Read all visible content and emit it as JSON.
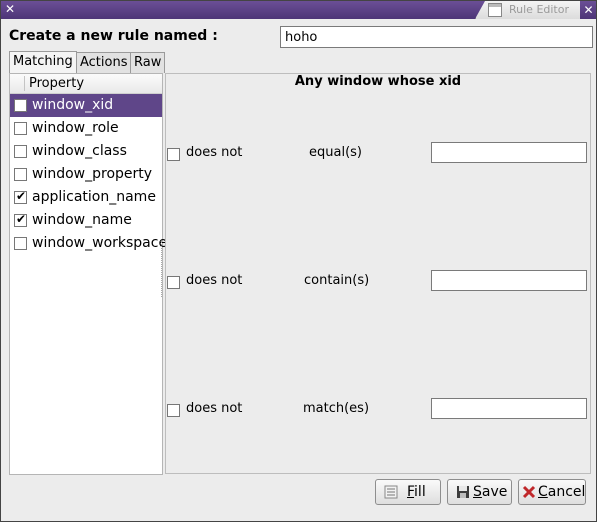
{
  "window": {
    "title": "Rule Editor",
    "menu_glyph": "✕",
    "close_glyph": "✕",
    "icon": "window-icon"
  },
  "form": {
    "name_label": "Create a new rule named :",
    "name_value": "hoho"
  },
  "tabs": [
    {
      "label": "Matching",
      "active": true
    },
    {
      "label": "Actions",
      "active": false
    },
    {
      "label": "Raw",
      "active": false
    }
  ],
  "property_list": {
    "header": "Property",
    "items": [
      {
        "label": "window_xid",
        "checked": false,
        "selected": true
      },
      {
        "label": "window_role",
        "checked": false,
        "selected": false
      },
      {
        "label": "window_class",
        "checked": false,
        "selected": false
      },
      {
        "label": "window_property",
        "checked": false,
        "selected": false
      },
      {
        "label": "application_name",
        "checked": true,
        "selected": false
      },
      {
        "label": "window_name",
        "checked": true,
        "selected": false
      },
      {
        "label": "window_workspace",
        "checked": false,
        "selected": false
      }
    ]
  },
  "matcher": {
    "title": "Any window whose xid",
    "conditions": [
      {
        "negate_label": "does not",
        "negated": false,
        "operator": "equal(s)",
        "value": ""
      },
      {
        "negate_label": "does not",
        "negated": false,
        "operator": "contain(s)",
        "value": ""
      },
      {
        "negate_label": "does not",
        "negated": false,
        "operator": "match(es)",
        "value": ""
      }
    ]
  },
  "buttons": {
    "fill": {
      "mnemonic": "F",
      "rest": "ill",
      "icon": "fill-icon"
    },
    "save": {
      "mnemonic": "S",
      "rest": "ave",
      "icon": "save-disk-icon"
    },
    "cancel": {
      "mnemonic": "C",
      "rest": "ancel",
      "icon": "cancel-x-icon"
    }
  },
  "colors": {
    "titlebar": "#5f4689",
    "selection": "#5f4689",
    "cancel_icon": "#c0282b"
  }
}
